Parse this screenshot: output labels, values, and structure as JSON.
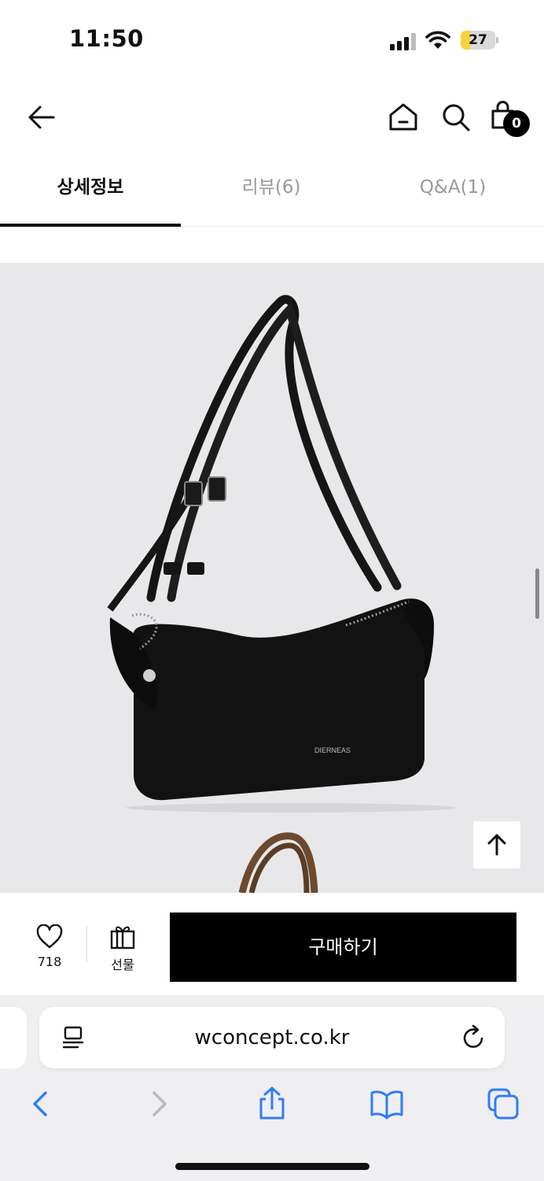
{
  "status_bar": {
    "time": "11:50",
    "battery_level": "27",
    "battery_fraction": 0.27,
    "battery_color": "#f5d33c"
  },
  "header": {
    "back_icon": "arrow-left-icon",
    "home_icon": "home-icon",
    "search_icon": "search-icon",
    "cart_icon": "shopping-bag-icon",
    "cart_count": "0"
  },
  "tabs": [
    {
      "label": "상세정보",
      "active": true
    },
    {
      "label": "리뷰(6)",
      "active": false
    },
    {
      "label": "Q&A(1)",
      "active": false
    }
  ],
  "product": {
    "background": "#e8e8ea",
    "brand_text": "DIERNEAS",
    "scroll_top_icon": "arrow-up-icon"
  },
  "purchase_bar": {
    "like_icon": "heart-icon",
    "like_count": "718",
    "gift_icon": "gift-icon",
    "gift_label": "선물",
    "buy_label": "구매하기"
  },
  "browser": {
    "url": "wconcept.co.kr",
    "reader_icon": "reader-icon",
    "reload_icon": "reload-icon",
    "back_icon": "chevron-left-icon",
    "forward_icon": "chevron-right-icon",
    "share_icon": "share-icon",
    "bookmarks_icon": "book-icon",
    "tabs_icon": "tabs-icon",
    "accent": "#2f7cf6"
  }
}
